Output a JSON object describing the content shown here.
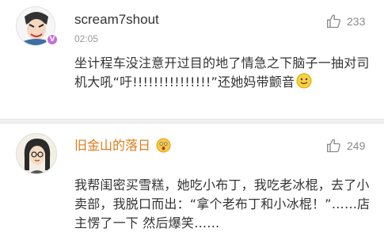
{
  "comments": [
    {
      "username": "scream7shout",
      "time": "02:05",
      "likes": "233",
      "text": "坐计程车没注意开过目的地了情急之下脑子一抽对司机大吼“吁!!!!!!!!!!!!!!!”还她妈带颤音",
      "avatar_icon": "cartoon-character-avatar",
      "badge": "V",
      "badge_color": "#c86be0",
      "emoji": "smile-emoji"
    },
    {
      "username": "旧金山的落日",
      "likes": "249",
      "text": "我帮闺密买雪糕，她吃小布丁，我吃老冰棍，去了小卖部，我脱口而出：“拿个老布丁和小冰棍！”……店主愣了一下 然后爆笑……",
      "avatar_icon": "cartoon-girl-avatar",
      "emoji": "surprised-emoji",
      "username_color": "#e07b1a"
    }
  ],
  "icons": {
    "like": "thumbs-up-icon"
  },
  "colors": {
    "muted": "#9a9a9a",
    "text": "#333333",
    "orange_name": "#e07b1a"
  }
}
